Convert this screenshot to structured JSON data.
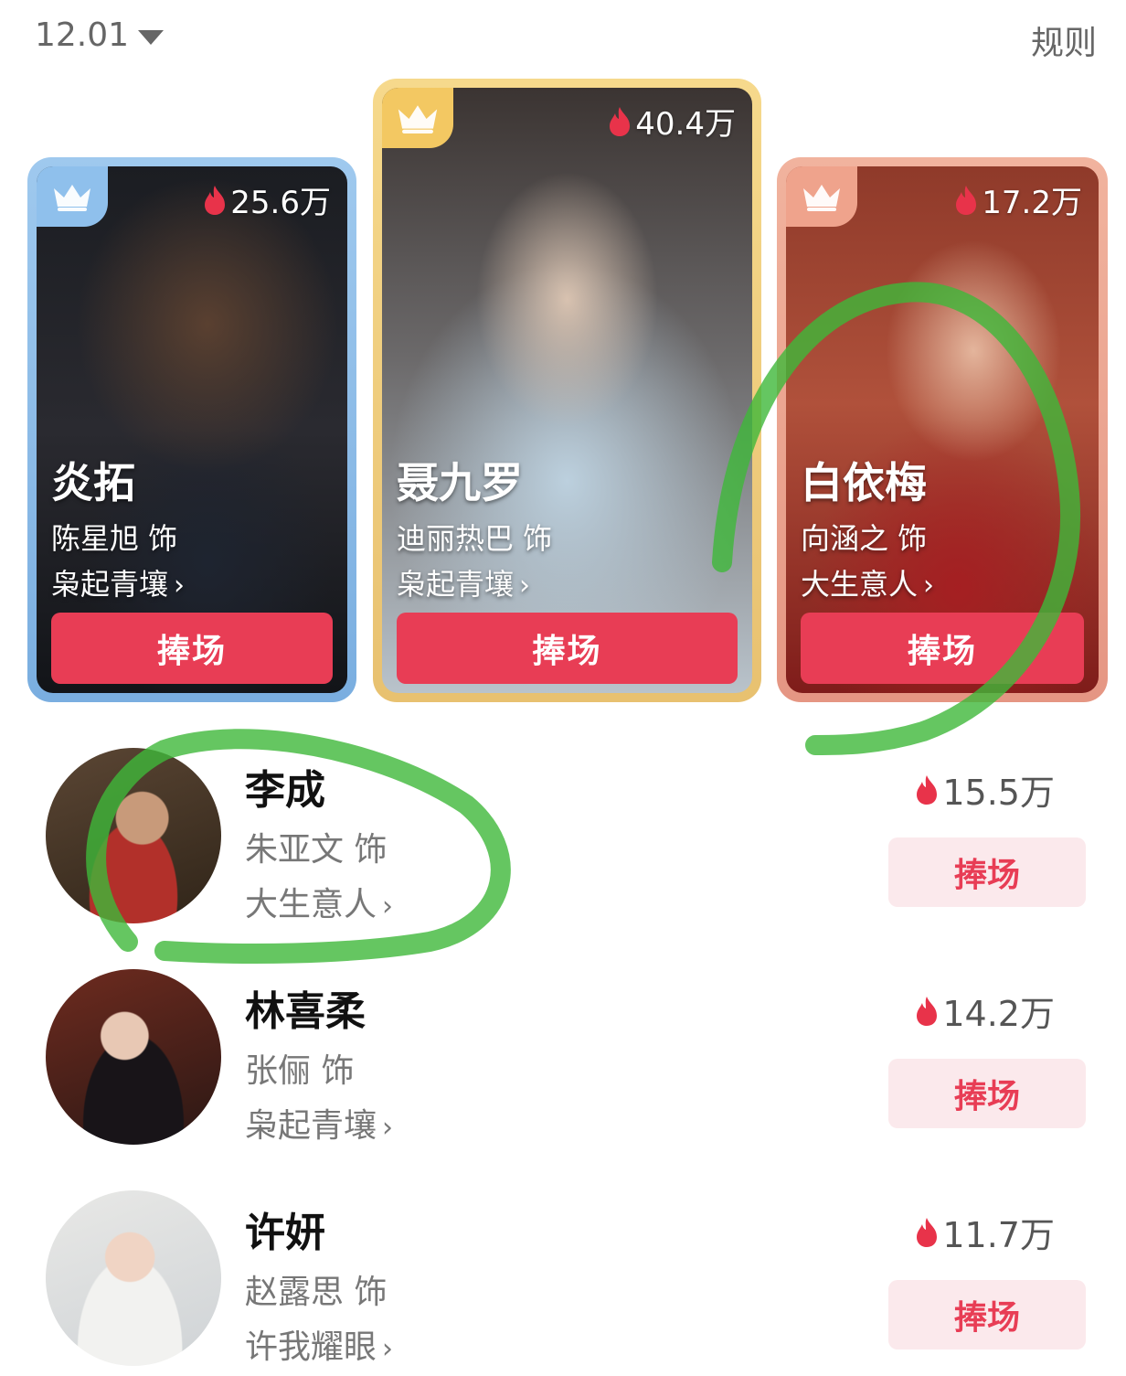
{
  "header": {
    "date": "12.01",
    "rules_label": "规则"
  },
  "podium": [
    {
      "rank": "2",
      "heat": "25.6万",
      "character": "炎拓",
      "actor": "陈星旭 饰",
      "drama": "枭起青壤",
      "button": "捧场",
      "accent": "#8fc0ec"
    },
    {
      "rank": "1",
      "heat": "40.4万",
      "character": "聂九罗",
      "actor": "迪丽热巴 饰",
      "drama": "枭起青壤",
      "button": "捧场",
      "accent": "#f3c862"
    },
    {
      "rank": "3",
      "heat": "17.2万",
      "character": "白依梅",
      "actor": "向涵之 饰",
      "drama": "大生意人",
      "button": "捧场",
      "accent": "#efa38c"
    }
  ],
  "list": [
    {
      "character": "李成",
      "actor": "朱亚文 饰",
      "drama": "大生意人",
      "heat": "15.5万",
      "button": "捧场"
    },
    {
      "character": "林喜柔",
      "actor": "张俪 饰",
      "drama": "枭起青壤",
      "heat": "14.2万",
      "button": "捧场"
    },
    {
      "character": "许妍",
      "actor": "赵露思 饰",
      "drama": "许我耀眼",
      "heat": "11.7万",
      "button": "捧场"
    }
  ],
  "colors": {
    "support_button": "#e83d55",
    "support_button_light": "#fbe9ec",
    "flame": "#e8334a",
    "highlight_marker": "#3fb83a"
  },
  "icons": {
    "flame": "flame-icon",
    "crown": "crown-icon",
    "dropdown": "caret-down-icon",
    "chevron": "chevron-right-icon"
  }
}
